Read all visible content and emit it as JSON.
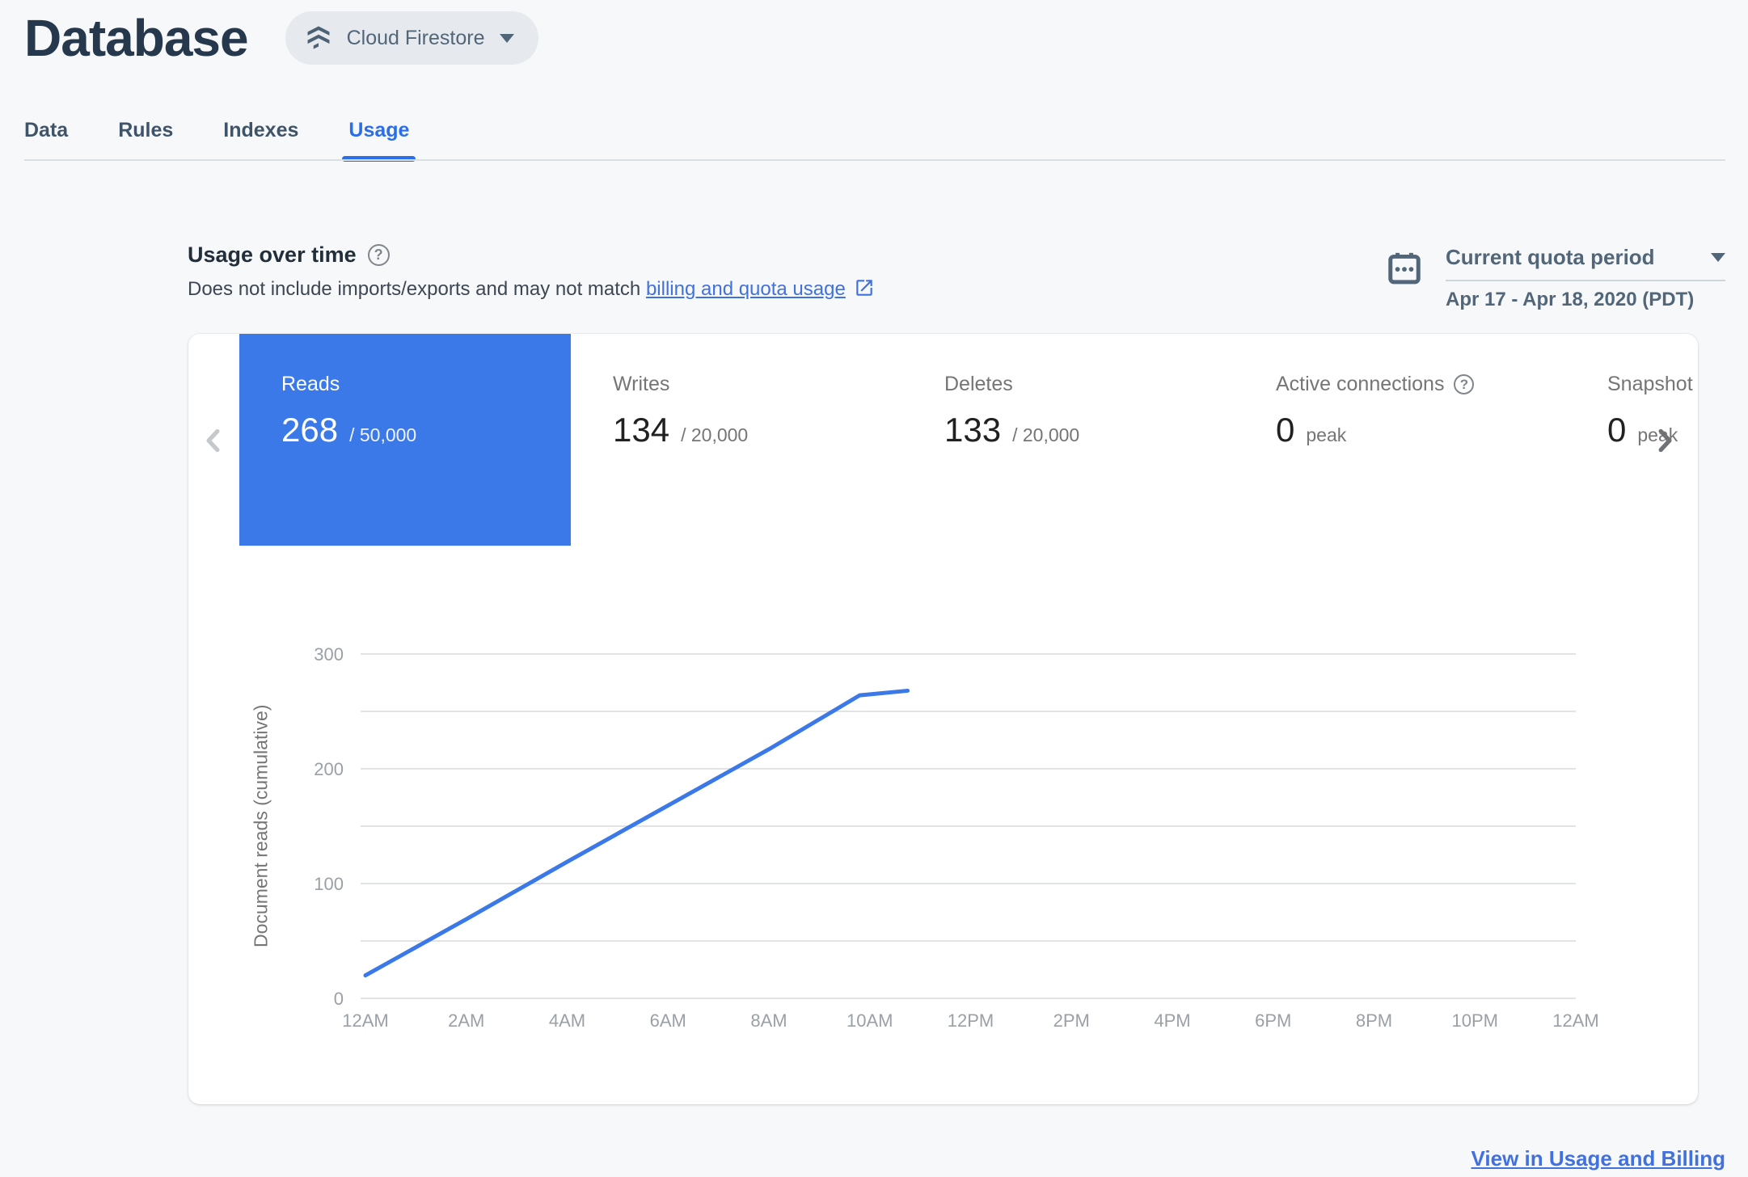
{
  "header": {
    "title": "Database",
    "product_selector": {
      "label": "Cloud Firestore"
    }
  },
  "tabs": [
    {
      "label": "Data",
      "active": false
    },
    {
      "label": "Rules",
      "active": false
    },
    {
      "label": "Indexes",
      "active": false
    },
    {
      "label": "Usage",
      "active": true
    }
  ],
  "usage_section": {
    "heading": "Usage over time",
    "subtitle_prefix": "Does not include imports/exports and may not match ",
    "subtitle_link": "billing and quota usage",
    "quota_period": {
      "label": "Current quota period",
      "range": "Apr 17 - Apr 18, 2020 (PDT)"
    }
  },
  "metric_cards": [
    {
      "label": "Reads",
      "value": "268",
      "suffix": "/ 50,000",
      "selected": true
    },
    {
      "label": "Writes",
      "value": "134",
      "suffix": "/ 20,000",
      "selected": false
    },
    {
      "label": "Deletes",
      "value": "133",
      "suffix": "/ 20,000",
      "selected": false
    },
    {
      "label": "Active connections",
      "value": "0",
      "suffix": "peak",
      "selected": false,
      "has_help": true
    },
    {
      "label": "Snapshot listeners",
      "value": "0",
      "suffix": "peak",
      "selected": false,
      "clipped": true
    }
  ],
  "chart_data": {
    "type": "line",
    "title": "",
    "xlabel": "",
    "ylabel": "Document reads (cumulative)",
    "x_tick_labels": [
      "12AM",
      "2AM",
      "4AM",
      "6AM",
      "8AM",
      "10AM",
      "12PM",
      "2PM",
      "4PM",
      "6PM",
      "8PM",
      "10PM",
      "12AM"
    ],
    "x_range_hours": [
      0,
      24
    ],
    "ylim": [
      0,
      300
    ],
    "y_major_ticks": [
      0,
      100,
      200,
      300
    ],
    "y_gridline_step": 50,
    "grid": true,
    "legend": "none",
    "series": [
      {
        "name": "Document reads (cumulative)",
        "color": "#3b78e8",
        "points_hours_value": [
          [
            0,
            20
          ],
          [
            2,
            69
          ],
          [
            4,
            119
          ],
          [
            6,
            168
          ],
          [
            8,
            217
          ],
          [
            9.8,
            264
          ],
          [
            10.75,
            268
          ]
        ]
      }
    ]
  },
  "footer": {
    "link_label": "View in Usage and Billing"
  },
  "icons": {
    "help_glyph": "?"
  },
  "colors": {
    "page_bg": "#f7f8f9",
    "title_color": "#25384c",
    "slate": "#52667a",
    "pill_bg": "#e6e9ed",
    "tab_inactive": "#3f5469",
    "tab_active": "#2a6ee8",
    "heading_color": "#222e3a",
    "subtitle_color": "#3c4753",
    "link_blue": "#4170df",
    "selected_card_bg": "#3b78e8",
    "chart_line": "#3b78e8",
    "muted_text": "#757575",
    "value_text": "#212121",
    "axis_text": "#9aa0a6",
    "gridline": "#e2e3e4",
    "divider": "#dadfe3"
  }
}
